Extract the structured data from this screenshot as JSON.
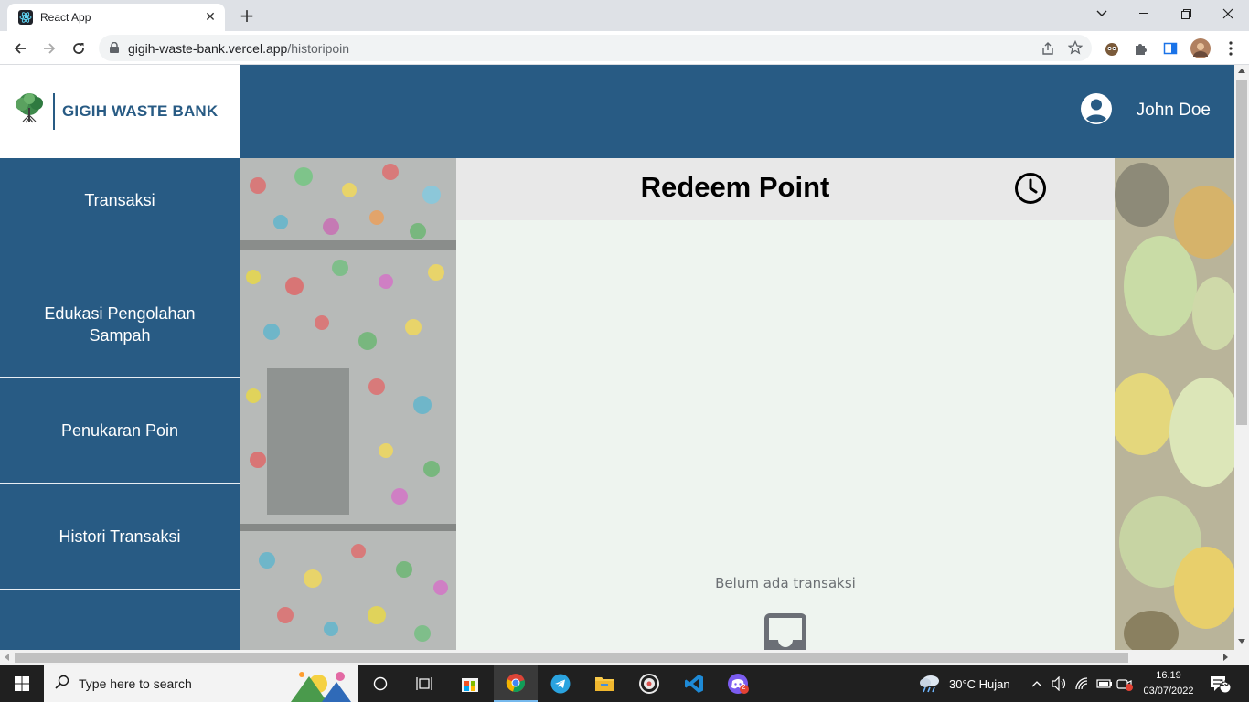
{
  "browser": {
    "tab_title": "React App",
    "url_host": "gigih-waste-bank.vercel.app",
    "url_path": "/historipoin"
  },
  "app": {
    "logo_text": "GIGIH WASTE BANK",
    "user_name": "John Doe",
    "accent_color": "#285b84"
  },
  "sidebar": {
    "items": [
      {
        "label": "Transaksi"
      },
      {
        "label": "Edukasi Pengolahan Sampah"
      },
      {
        "label": "Penukaran Poin"
      },
      {
        "label": "Histori Transaksi"
      }
    ]
  },
  "main": {
    "title": "Redeem Point",
    "empty_message": "Belum ada transaksi"
  },
  "taskbar": {
    "search_placeholder": "Type here to search",
    "weather": "30°C  Hujan",
    "time": "16.19",
    "date": "03/07/2022",
    "notification_count": "13",
    "discord_badge": "2"
  }
}
